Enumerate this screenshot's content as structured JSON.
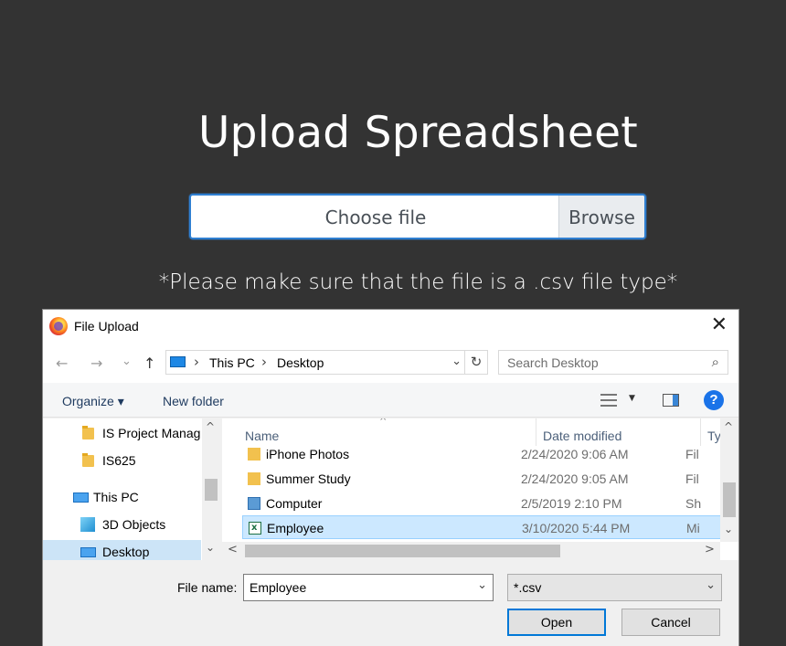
{
  "page": {
    "title": "Upload Spreadsheet",
    "file_placeholder": "Choose file",
    "browse_label": "Browse",
    "note": "*Please make sure that the file is a .csv file type*"
  },
  "dialog": {
    "title": "File Upload",
    "close_glyph": "✕",
    "nav": {
      "back": "←",
      "forward": "→",
      "recent": "⌄",
      "up": "↑"
    },
    "address": {
      "crumbs": [
        "This PC",
        "Desktop"
      ],
      "sep": "›",
      "drop": "⌄",
      "refresh": "↻"
    },
    "search": {
      "placeholder": "Search Desktop",
      "icon": "⌕"
    },
    "toolbar": {
      "organize": "Organize ▾",
      "new_folder": "New folder",
      "view_drop": "▼",
      "help": "?"
    },
    "tree": [
      {
        "label": "IS Project Manag",
        "icon": "folder-icon"
      },
      {
        "label": "IS625",
        "icon": "folder-icon"
      },
      {
        "label": "This PC",
        "icon": "computer-icon"
      },
      {
        "label": "3D Objects",
        "icon": "3d-objects-icon"
      },
      {
        "label": "Desktop",
        "icon": "desktop-icon",
        "selected": true
      }
    ],
    "columns": {
      "name": "Name",
      "date": "Date modified",
      "type": "Ty"
    },
    "sort_indicator": "^",
    "files": [
      {
        "name": "iPhone Photos",
        "date": "2/24/2020 9:06 AM",
        "type": "Fil",
        "icon": "folder-icon"
      },
      {
        "name": "Summer Study",
        "date": "2/24/2020 9:05 AM",
        "type": "Fil",
        "icon": "folder-icon"
      },
      {
        "name": "Computer",
        "date": "2/5/2019 2:10 PM",
        "type": "Sh",
        "icon": "computer-shortcut-icon"
      },
      {
        "name": "Employee",
        "date": "3/10/2020 5:44 PM",
        "type": "Mi",
        "icon": "excel-csv-icon",
        "selected": true
      }
    ],
    "scroll": {
      "up": "^",
      "down": "⌄",
      "left": "<",
      "right": ">"
    },
    "file_name_label": "File name:",
    "file_name_value": "Employee",
    "file_type_value": "*.csv",
    "dropdown_glyph": "⌄",
    "open_label": "Open",
    "cancel_label": "Cancel"
  },
  "colors": {
    "background": "#333333",
    "accent": "#0078d7",
    "selection": "#cce8ff"
  }
}
